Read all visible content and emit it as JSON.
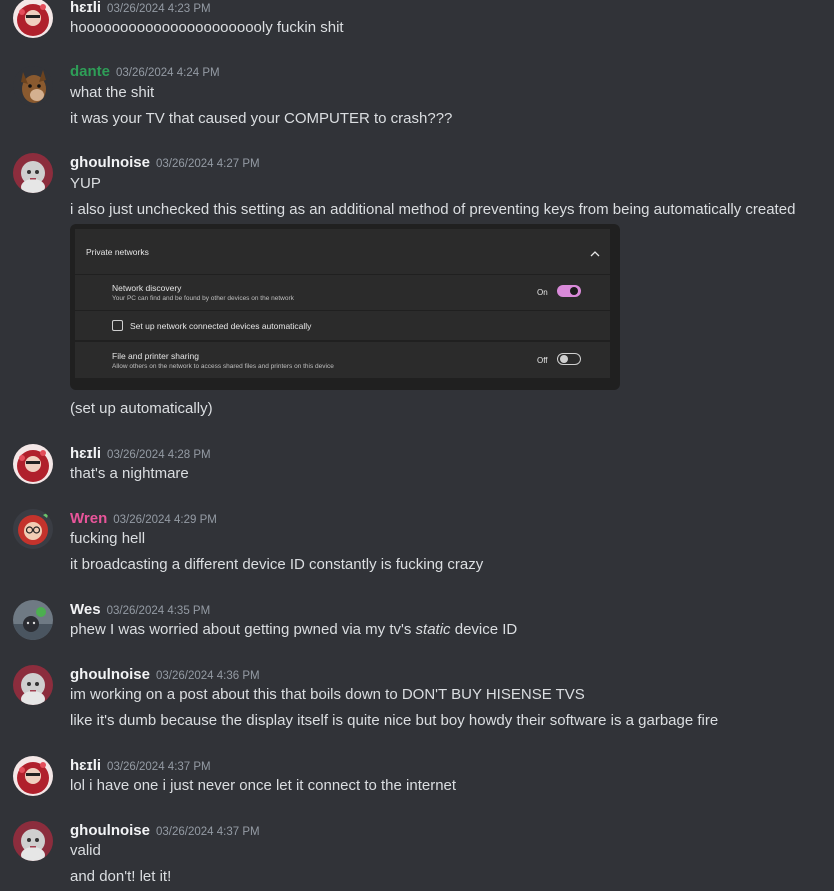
{
  "messages": [
    {
      "user": "hɛɪli",
      "time": "03/26/2024 4:23 PM",
      "lines": [
        "hooooooooooooooooooooooly fuckin shit"
      ]
    },
    {
      "user": "dante",
      "time": "03/26/2024 4:24 PM",
      "lines": [
        "what the shit",
        "it was your TV that caused your COMPUTER to crash???"
      ]
    },
    {
      "user": "ghoulnoise",
      "time": "03/26/2024 4:27 PM",
      "lines": [
        "YUP",
        "i also just unchecked this setting as an additional method of preventing keys from being automatically created",
        "(set up automatically)"
      ]
    },
    {
      "user": "hɛɪli",
      "time": "03/26/2024 4:28 PM",
      "lines": [
        "that's a nightmare"
      ]
    },
    {
      "user": "Wren",
      "time": "03/26/2024 4:29 PM",
      "lines": [
        "fucking hell",
        "it broadcasting a different device ID constantly is fucking crazy"
      ]
    },
    {
      "user": "Wes",
      "time": "03/26/2024 4:35 PM",
      "lines": {
        "before": "phew I was worried about getting pwned via my tv's ",
        "em": "static",
        "after": " device ID"
      }
    },
    {
      "user": "ghoulnoise",
      "time": "03/26/2024 4:36 PM",
      "lines": [
        "im working on a post about this that boils down to DON'T BUY HISENSE TVS",
        "like it's dumb because the display itself is quite nice but boy howdy their software is a garbage fire"
      ]
    },
    {
      "user": "hɛɪli",
      "time": "03/26/2024 4:37 PM",
      "lines": [
        "lol i have one i just never once let it connect to the internet"
      ]
    },
    {
      "user": "ghoulnoise",
      "time": "03/26/2024 4:37 PM",
      "lines": [
        "valid",
        "and don't! let it!"
      ]
    }
  ],
  "username_colors": {
    "default": "#f2f3f5",
    "dante": "#2e9e57",
    "wren": "#e8559a"
  },
  "embed": {
    "section_title": "Private networks",
    "network_discovery_title": "Network discovery",
    "network_discovery_sub": "Your PC can find and be found by other devices on the network",
    "network_discovery_state": "On",
    "auto_setup_label": "Set up network connected devices automatically",
    "file_sharing_title": "File and printer sharing",
    "file_sharing_sub": "Allow others on the network to access shared files and printers on this device",
    "file_sharing_state": "Off",
    "toggle_on_color": "#d98ad9"
  },
  "icons": [
    "chevron-up-icon"
  ]
}
